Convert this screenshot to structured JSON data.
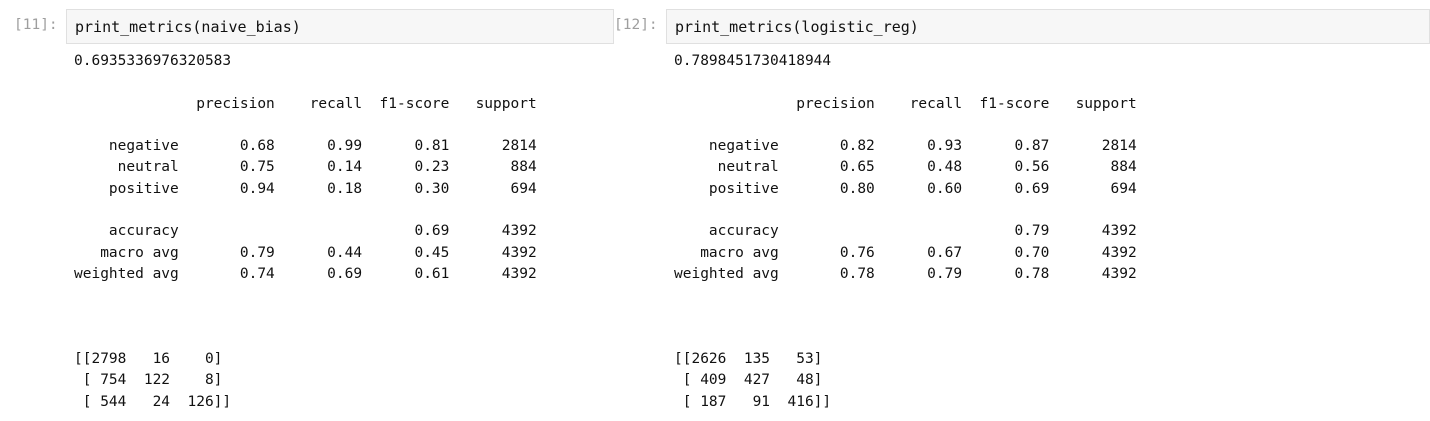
{
  "cells": [
    {
      "prompt": "[11]:",
      "code": "print_metrics(naive_bias)",
      "output": "0.6935336976320583\n\n              precision    recall  f1-score   support\n\n    negative       0.68      0.99      0.81      2814\n     neutral       0.75      0.14      0.23       884\n    positive       0.94      0.18      0.30       694\n\n    accuracy                           0.69      4392\n   macro avg       0.79      0.44      0.45      4392\nweighted avg       0.74      0.69      0.61      4392\n\n\n\n[[2798   16    0]\n [ 754  122    8]\n [ 544   24  126]]"
    },
    {
      "prompt": "[12]:",
      "code": "print_metrics(logistic_reg)",
      "output": "0.7898451730418944\n\n              precision    recall  f1-score   support\n\n    negative       0.82      0.93      0.87      2814\n     neutral       0.65      0.48      0.56       884\n    positive       0.80      0.60      0.69       694\n\n    accuracy                           0.79      4392\n   macro avg       0.76      0.67      0.70      4392\nweighted avg       0.78      0.79      0.78      4392\n\n\n\n[[2626  135   53]\n [ 409  427   48]\n [ 187   91  416]]"
    }
  ]
}
